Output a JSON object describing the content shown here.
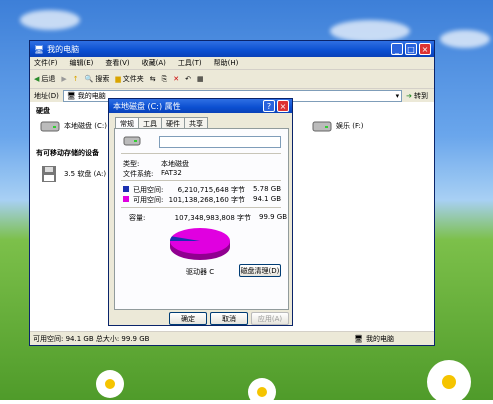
{
  "explorer": {
    "title": "我的电脑",
    "menu": [
      "文件(F)",
      "编辑(E)",
      "查看(V)",
      "收藏(A)",
      "工具(T)",
      "帮助(H)"
    ],
    "toolbar": {
      "back": "后退",
      "search": "搜索",
      "folders": "文件夹"
    },
    "address_label": "地址(D)",
    "address_value": "我的电脑",
    "go": "转到",
    "section_hdd": "硬盘",
    "section_removable": "有可移动存储的设备",
    "drives": {
      "c": "本地磁盘 (C:)",
      "e": "娱乐 (F:)",
      "floppy": "3.5 软盘 (A:)"
    },
    "status_left": "可用空间: 94.1 GB 总大小: 99.9 GB",
    "status_right": "我的电脑"
  },
  "dialog": {
    "title": "本地磁盘 (C:) 属性",
    "tabs": [
      "常规",
      "工具",
      "硬件",
      "共享"
    ],
    "name_value": "",
    "type_label": "类型:",
    "type_value": "本地磁盘",
    "fs_label": "文件系统:",
    "fs_value": "FAT32",
    "used_label": "已用空间:",
    "used_bytes": "6,210,715,648 字节",
    "used_size": "5.78 GB",
    "free_label": "可用空间:",
    "free_bytes": "101,138,268,160 字节",
    "free_size": "94.1 GB",
    "capacity_label": "容量:",
    "capacity_bytes": "107,348,983,808 字节",
    "capacity_size": "99.9 GB",
    "drive_label": "驱动器 C",
    "cleanup": "磁盘清理(D)",
    "ok": "确定",
    "cancel": "取消",
    "apply": "应用(A)",
    "used_color": "#1a2fb0",
    "free_color": "#e000e0",
    "used_fraction": 0.0578
  }
}
